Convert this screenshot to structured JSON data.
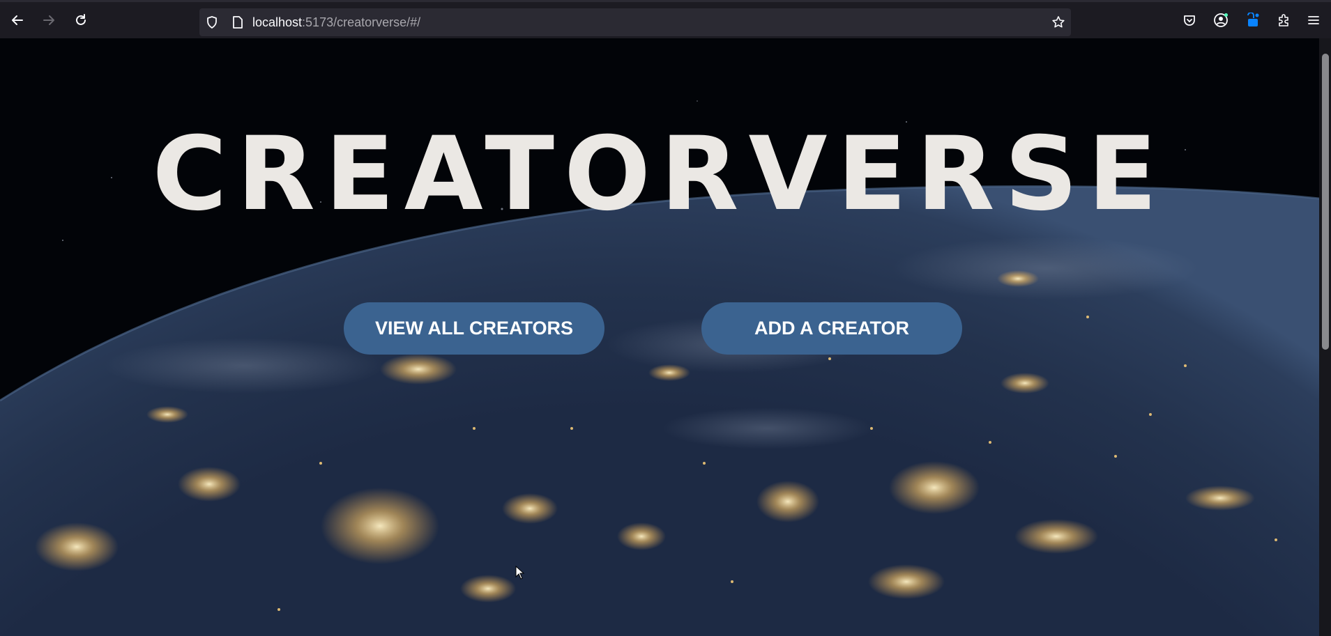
{
  "browser": {
    "url_host": "localhost",
    "url_rest": ":5173/creatorverse/#/",
    "icons": {
      "back": "back-arrow-icon",
      "forward": "forward-arrow-icon",
      "reload": "reload-icon",
      "shield": "shield-icon",
      "page": "page-icon",
      "bookmark": "star-icon",
      "pocket": "pocket-icon",
      "account": "account-icon",
      "extension_lock": "lock-extension-icon",
      "extensions": "puzzle-icon",
      "menu": "hamburger-menu-icon"
    }
  },
  "page": {
    "title": "CREATORVERSE",
    "buttons": {
      "view_all": "VIEW ALL CREATORS",
      "add": "ADD A CREATOR"
    }
  },
  "colors": {
    "button_bg": "#3b6390",
    "title_color": "#ebe8e4",
    "toolbar_bg": "#1c1b22",
    "urlbar_bg": "#2b2a33"
  }
}
